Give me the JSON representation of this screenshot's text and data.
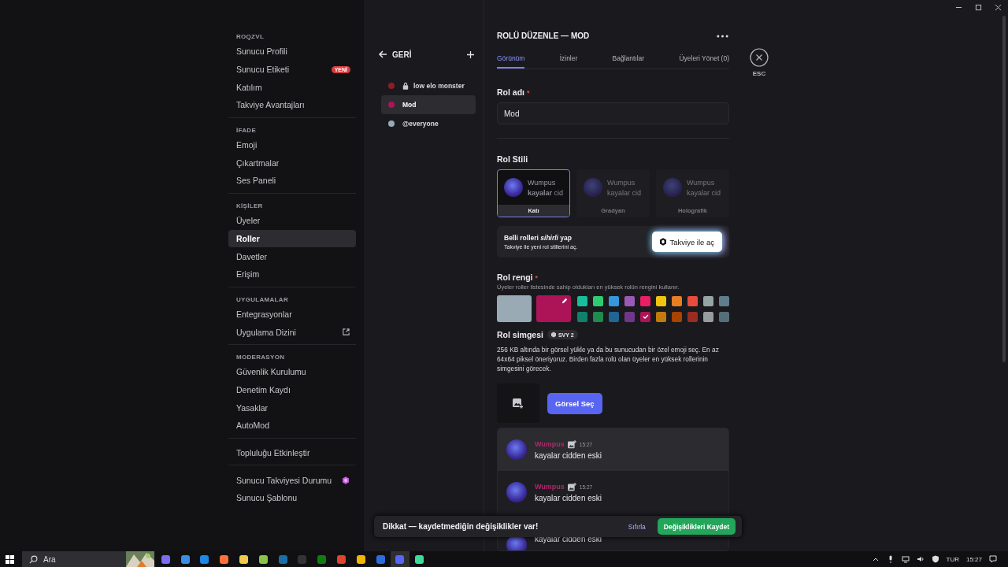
{
  "sidebar": {
    "sections": [
      {
        "header": "ROQZVL",
        "items": [
          {
            "label": "Sunucu Profili",
            "selected": false,
            "kind": "plain"
          },
          {
            "label": "Sunucu Etiketi",
            "selected": false,
            "kind": "badge",
            "badge": "YENİ"
          },
          {
            "label": "Katılım",
            "selected": false,
            "kind": "plain"
          },
          {
            "label": "Takviye Avantajları",
            "selected": false,
            "kind": "plain"
          }
        ]
      },
      {
        "header": "İFADE",
        "items": [
          {
            "label": "Emoji",
            "selected": false,
            "kind": "plain"
          },
          {
            "label": "Çıkartmalar",
            "selected": false,
            "kind": "plain"
          },
          {
            "label": "Ses Paneli",
            "selected": false,
            "kind": "plain"
          }
        ]
      },
      {
        "header": "KİŞİLER",
        "items": [
          {
            "label": "Üyeler",
            "selected": false,
            "kind": "plain"
          },
          {
            "label": "Roller",
            "selected": true,
            "kind": "plain"
          },
          {
            "label": "Davetler",
            "selected": false,
            "kind": "plain"
          },
          {
            "label": "Erişim",
            "selected": false,
            "kind": "plain"
          }
        ]
      },
      {
        "header": "UYGULAMALAR",
        "items": [
          {
            "label": "Entegrasyonlar",
            "selected": false,
            "kind": "plain"
          },
          {
            "label": "Uygulama Dizini",
            "selected": false,
            "kind": "link"
          }
        ]
      },
      {
        "header": "MODERASYON",
        "items": [
          {
            "label": "Güvenlik Kurulumu",
            "selected": false,
            "kind": "plain"
          },
          {
            "label": "Denetim Kaydı",
            "selected": false,
            "kind": "plain"
          },
          {
            "label": "Yasaklar",
            "selected": false,
            "kind": "plain"
          },
          {
            "label": "AutoMod",
            "selected": false,
            "kind": "plain"
          }
        ]
      },
      {
        "items": [
          {
            "label": "Topluluğu Etkinleştir",
            "selected": false,
            "kind": "plain"
          }
        ]
      },
      {
        "items": [
          {
            "label": "Sunucu Takviyesi Durumu",
            "selected": false,
            "kind": "boost"
          },
          {
            "label": "Sunucu Şablonu",
            "selected": false,
            "kind": "plain"
          }
        ]
      }
    ]
  },
  "roles_panel": {
    "back_label": "GERİ",
    "roles": [
      {
        "name": "low elo monster",
        "color": "#8e1c24",
        "locked": true,
        "selected": false
      },
      {
        "name": "Mod",
        "color": "#ad1457",
        "locked": false,
        "selected": true
      },
      {
        "name": "@everyone",
        "color": "#99aab5",
        "locked": false,
        "selected": false
      }
    ]
  },
  "editor": {
    "title": "ROLÜ DÜZENLE — MOD",
    "close_label": "ESC",
    "tabs": [
      {
        "label": "Görünüm",
        "selected": true
      },
      {
        "label": "İzinler",
        "selected": false
      },
      {
        "label": "Bağlantılar",
        "selected": false
      },
      {
        "label": "Üyeleri Yönet (0)",
        "selected": false
      }
    ],
    "name_label": {
      "text": "Rol adı",
      "mark": "*"
    },
    "name_value": "Mod",
    "style_label": "Rol Stili",
    "styles": [
      {
        "label": "Katı",
        "preview_name": "Wumpus",
        "preview_text": "**kayalar** cid",
        "selected": true,
        "disabled": false
      },
      {
        "label": "Gradyan",
        "preview_name": "Wumpus",
        "preview_text": "kayalar cid",
        "selected": false,
        "disabled": true
      },
      {
        "label": "Holografik",
        "preview_name": "Wumpus",
        "preview_text": "kayalar cid",
        "selected": false,
        "disabled": true
      }
    ],
    "boost_banner": {
      "title": "Belli rolleri *sihirli* yap",
      "subtitle": "Takviye ile yeni rol stillerini aç.",
      "button": "Takviye ile aç"
    },
    "color_label": {
      "text": "Rol rengi",
      "mark": "*"
    },
    "color_hint": "Üyeler roller listesinde sahip oldukları en yüksek rolün rengini kullanır.",
    "main_swatches": [
      {
        "kind": "default",
        "color": "#99aab5"
      },
      {
        "kind": "custom",
        "color": "#ad1457"
      }
    ],
    "swatch_rows": [
      [
        {
          "color": "#1abc9c",
          "selected": false
        },
        {
          "color": "#2ecc71",
          "selected": false
        },
        {
          "color": "#3498db",
          "selected": false
        },
        {
          "color": "#9b59b6",
          "selected": false
        },
        {
          "color": "#e91e63",
          "selected": false
        },
        {
          "color": "#f1c40f",
          "selected": false
        },
        {
          "color": "#e67e22",
          "selected": false
        },
        {
          "color": "#e74c3c",
          "selected": false
        },
        {
          "color": "#95a5a6",
          "selected": false
        },
        {
          "color": "#607d8b",
          "selected": false
        }
      ],
      [
        {
          "color": "#11806a",
          "selected": false
        },
        {
          "color": "#1f8b4c",
          "selected": false
        },
        {
          "color": "#206694",
          "selected": false
        },
        {
          "color": "#71368a",
          "selected": false
        },
        {
          "color": "#ad1457",
          "selected": true
        },
        {
          "color": "#c27c0e",
          "selected": false
        },
        {
          "color": "#a84300",
          "selected": false
        },
        {
          "color": "#992d22",
          "selected": false
        },
        {
          "color": "#979c9f",
          "selected": false
        },
        {
          "color": "#546e7a",
          "selected": false
        }
      ]
    ],
    "icon_label": "Rol simgesi",
    "icon_badge": "SVY 2",
    "icon_hint": "256 KB altında bir görsel yükle ya da bu sunucudan bir özel emoji seç. En az 64x64 piksel öneriyoruz. Birden fazla rolü olan üyeler en yüksek rollerinin simgesini görecek.",
    "choose_button": "Görsel Seç",
    "preview_messages": [
      {
        "name": "Wumpus",
        "time": "15:27",
        "text": "kayalar cidden eski"
      },
      {
        "name": "Wumpus",
        "time": "15:27",
        "text": "kayalar cidden eski"
      },
      {
        "text": "kayalar cidden eski"
      }
    ]
  },
  "save_bar": {
    "message": "Dikkat — kaydetmediğin değişiklikler var!",
    "reset": "Sıfırla",
    "save": "Değişiklikleri Kaydet"
  },
  "taskbar": {
    "search_placeholder": "Ara",
    "language": "TUR",
    "time": "15:27"
  }
}
